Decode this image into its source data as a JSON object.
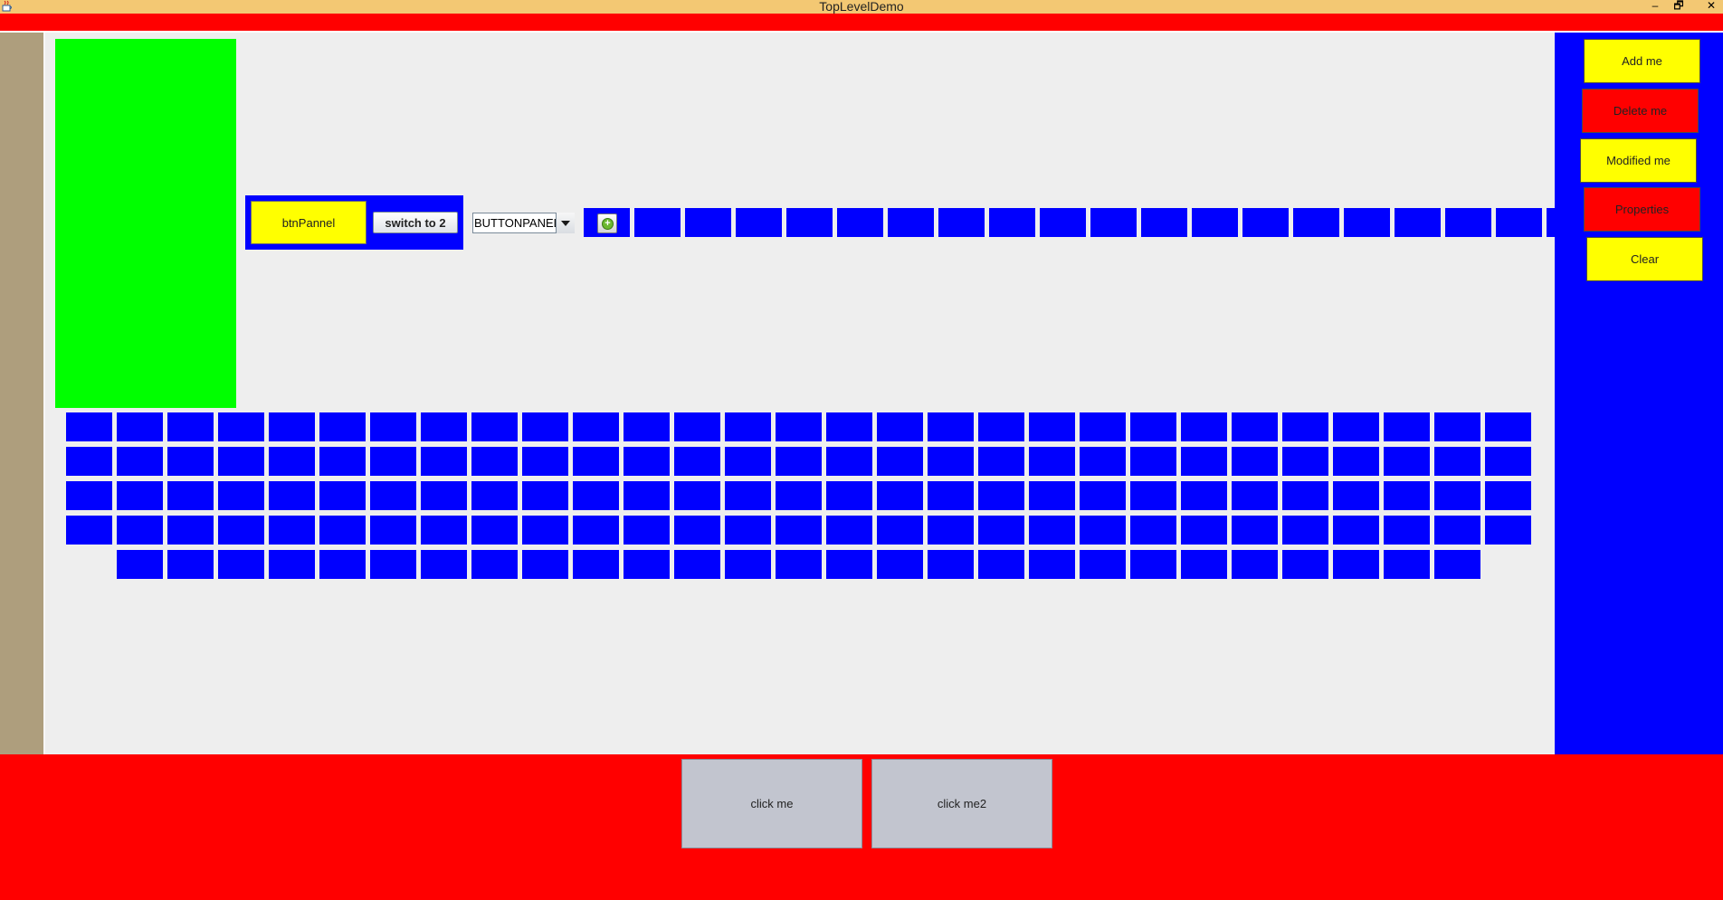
{
  "window": {
    "title": "TopLevelDemo",
    "controls": {
      "minimize": "–",
      "restore": "🗗",
      "close": "✕"
    },
    "app_icon": "java-cup-icon"
  },
  "toolbar": {
    "btn_panel_label": "btnPannel",
    "switch_label": "switch to 2",
    "combo_value": "BUTTONPANEL",
    "add_icon": "add-circle-icon",
    "add_symbol": "+",
    "top_blue_button_count": 19
  },
  "grid": {
    "rows_full": 4,
    "cols_full": 29,
    "last_row_count": 27
  },
  "right_panel": {
    "buttons": [
      {
        "label": "Add me",
        "color": "#ffff00"
      },
      {
        "label": "Delete me",
        "color": "#ff0000"
      },
      {
        "label": "Modified me",
        "color": "#ffff00"
      },
      {
        "label": "Properties",
        "color": "#ff0000"
      },
      {
        "label": "Clear",
        "color": "#ffff00"
      }
    ]
  },
  "bottom_panel": {
    "buttons": [
      {
        "label": "click me"
      },
      {
        "label": "click me2"
      }
    ]
  },
  "colors": {
    "title_bar": "#f3c873",
    "menu_strip": "#ff0000",
    "left_bar": "#ae9e7d",
    "green_panel": "#00ff00",
    "blue": "#0000ff",
    "yellow": "#ffff00",
    "red": "#ff0000",
    "grey_button": "#c2c5cf",
    "background": "#eeeeee"
  }
}
